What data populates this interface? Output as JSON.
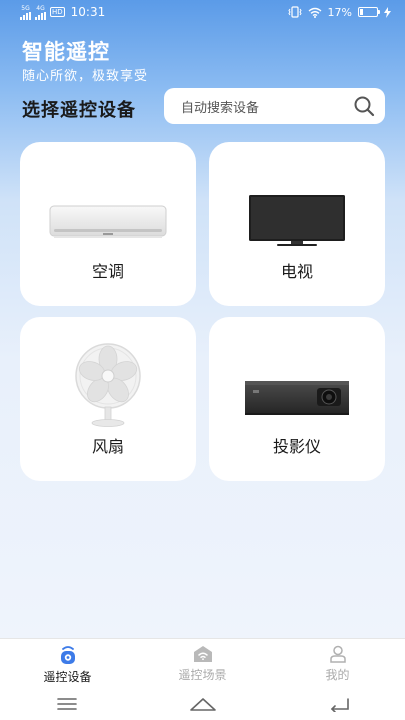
{
  "status_bar": {
    "net1": "5G",
    "net2": "4G",
    "hd": "HD",
    "time": "10:31",
    "battery": "17%",
    "battery_level": 0.17
  },
  "header": {
    "title": "智能遥控",
    "subtitle": "随心所欲，极致享受"
  },
  "section": {
    "title": "选择遥控设备"
  },
  "search": {
    "placeholder": "自动搜索设备",
    "icon": "search-icon"
  },
  "devices": [
    {
      "label": "空调",
      "icon": "air-conditioner-icon"
    },
    {
      "label": "电视",
      "icon": "tv-icon"
    },
    {
      "label": "风扇",
      "icon": "fan-icon"
    },
    {
      "label": "投影仪",
      "icon": "projector-icon"
    }
  ],
  "bottom_nav": [
    {
      "label": "遥控设备",
      "icon": "remote-icon",
      "active": true
    },
    {
      "label": "遥控场景",
      "icon": "scene-icon",
      "active": false
    },
    {
      "label": "我的",
      "icon": "user-icon",
      "active": false
    }
  ],
  "system_nav": [
    "menu-icon",
    "home-icon",
    "back-icon"
  ],
  "colors": {
    "accent": "#3d7be8",
    "background_top": "#5b9be8",
    "card": "#ffffff"
  }
}
